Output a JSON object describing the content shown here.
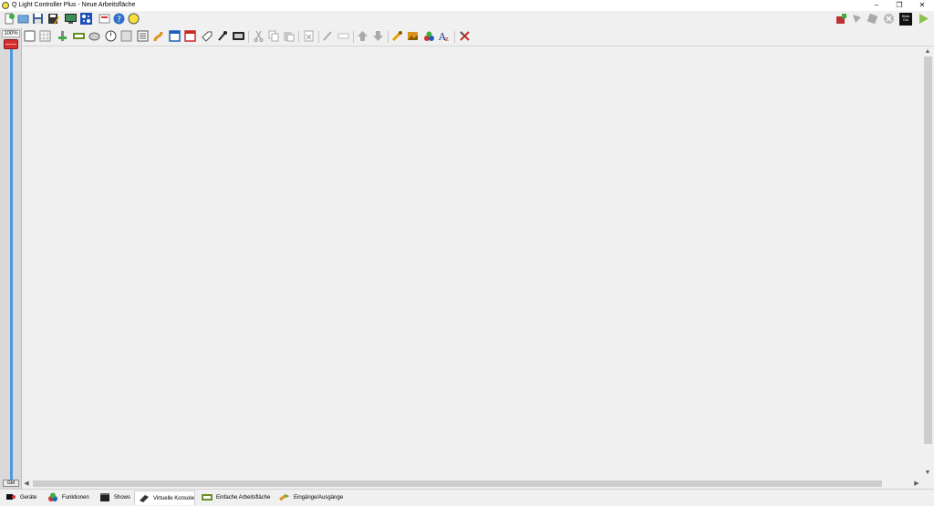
{
  "window": {
    "title": "Q Light Controller Plus - Neue Arbeitsfläche",
    "minimize_glyph": "–",
    "restore_glyph": "❐",
    "close_glyph": "✕"
  },
  "grand_master": {
    "percent_label": "100%",
    "button_label": "GM",
    "level": 1.0
  },
  "scrollbars": {
    "up_arrow": "▲",
    "down_arrow": "▼",
    "left_arrow": "◀",
    "right_arrow": "▶"
  },
  "tabs": [
    {
      "label": "Geräte",
      "icon": "fixtures-icon",
      "active": false
    },
    {
      "label": "Funktionen",
      "icon": "functions-icon",
      "active": false
    },
    {
      "label": "Shows",
      "icon": "shows-icon",
      "active": false
    },
    {
      "label": "Virtuelle Konsole",
      "icon": "virtual-console-icon",
      "active": true
    },
    {
      "label": "Einfache Arbeitsfläche",
      "icon": "simple-desk-icon",
      "active": false
    },
    {
      "label": "Eingänge/Ausgänge",
      "icon": "input-output-icon",
      "active": false
    }
  ],
  "blackout_label": "Black Out",
  "colors": {
    "accent_blue": "#4f97e3",
    "gm_knob": "#d32f2f",
    "active_tab": "#ffffff",
    "background": "#f0f0f0"
  }
}
